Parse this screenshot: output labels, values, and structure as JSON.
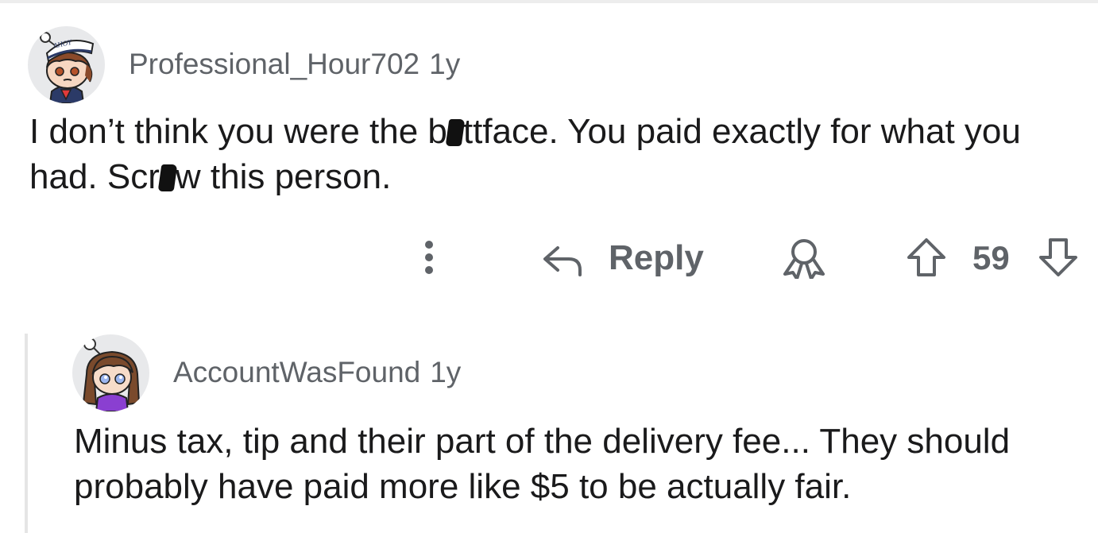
{
  "comments": [
    {
      "username": "Professional_Hour702",
      "age": "1y",
      "avatar_icon": "sailor-hat-snoo-avatar",
      "avatar_badge_text": "AHOY",
      "body_parts": [
        "I don’t think you were the b",
        "ttface. You paid exactly for what you had. Scr",
        "w this person."
      ],
      "actions": {
        "more_icon": "vertical-ellipsis-icon",
        "reply_label": "Reply",
        "award_icon": "award-icon",
        "upvote_icon": "upvote-arrow-icon",
        "score": "59",
        "downvote_icon": "downvote-arrow-icon"
      }
    },
    {
      "username": "AccountWasFound",
      "age": "1y",
      "avatar_icon": "brown-hair-snoo-avatar",
      "body": "Minus tax, tip and their part of the delivery fee... They should probably have paid more like $5 to be actually fair."
    }
  ],
  "colors": {
    "meta_text": "#5f6368",
    "body_text": "#1a1a1b",
    "thread_line": "#e5e5e5"
  }
}
